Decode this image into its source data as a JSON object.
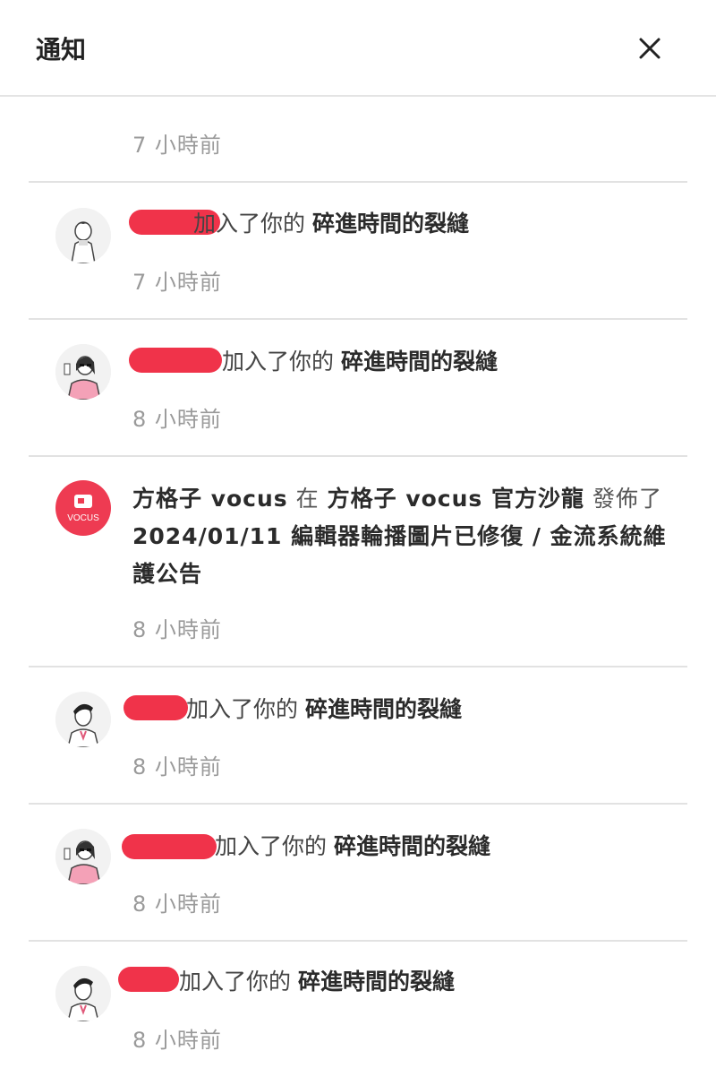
{
  "header": {
    "title": "通知"
  },
  "notifications": [
    {
      "time": "7 小時前"
    },
    {
      "action": "加入了你的",
      "target": "碎進時間的裂縫",
      "time": "7 小時前"
    },
    {
      "action": "加入了你的",
      "target": "碎進時間的裂縫",
      "time": "8 小時前"
    },
    {
      "actor": "方格子 vocus",
      "prep": "在",
      "location": "方格子 vocus 官方沙龍",
      "verb": "發佈了",
      "post_title": "2024/01/11 編輯器輪播圖片已修復 / 金流系統維護公告",
      "avatar_text": "VOCUS",
      "time": "8 小時前"
    },
    {
      "action": "加入了你的",
      "target": "碎進時間的裂縫",
      "time": "8 小時前"
    },
    {
      "action": "加入了你的",
      "target": "碎進時間的裂縫",
      "time": "8 小時前"
    },
    {
      "action": "加入了你的",
      "target": "碎進時間的裂縫",
      "time": "8 小時前"
    }
  ],
  "colors": {
    "brand": "#ee3b52",
    "redaction": "#f0334a",
    "divider": "#e2e2e2",
    "muted": "#9a9a9a"
  },
  "icons": {
    "close": "close-icon",
    "vocus": "vocus-logo-icon"
  }
}
